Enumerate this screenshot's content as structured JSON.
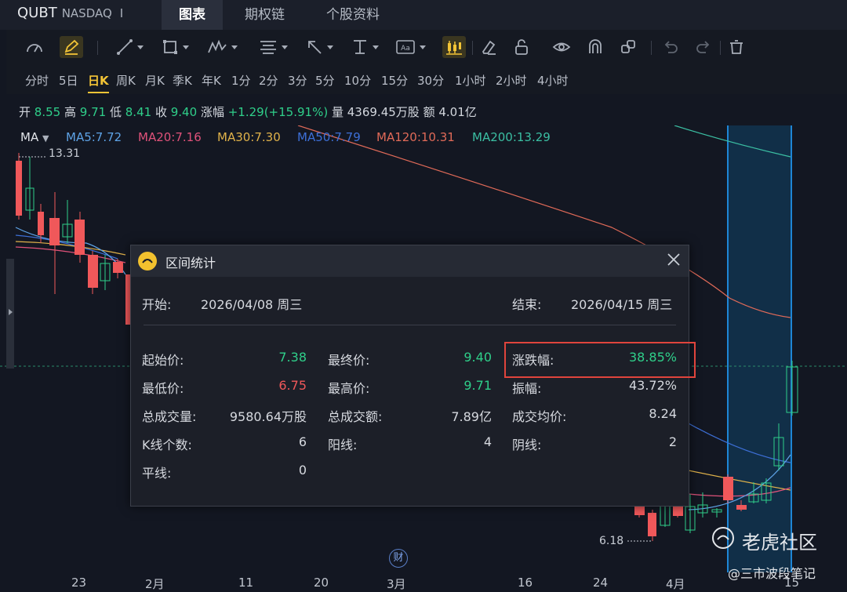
{
  "header": {
    "symbol": "QUBT",
    "exchange": "NASDAQ",
    "separator": "I",
    "tabs": [
      {
        "label": "图表",
        "active": true
      },
      {
        "label": "期权链",
        "active": false
      },
      {
        "label": "个股资料",
        "active": false
      }
    ]
  },
  "toolbar": {
    "icons": [
      "gauge-icon",
      "pencil-icon",
      "line-icon",
      "rectangle-icon",
      "pattern-icon",
      "fib-icon",
      "arrow-icon",
      "measure-icon",
      "text-icon",
      "candle-settings-icon",
      "eraser-icon",
      "lock-icon",
      "eye-icon",
      "magnet-icon",
      "layers-icon",
      "undo-icon",
      "redo-icon",
      "trash-icon"
    ],
    "accent": "#f3c436"
  },
  "periods": [
    "分时",
    "5日",
    "日K",
    "周K",
    "月K",
    "季K",
    "年K",
    "1分",
    "2分",
    "3分",
    "5分",
    "10分",
    "15分",
    "30分",
    "1小时",
    "2小时",
    "4小时"
  ],
  "active_period": "日K",
  "quote": {
    "open_label": "开",
    "open": "8.55",
    "high_label": "高",
    "high": "9.71",
    "low_label": "低",
    "low": "8.41",
    "close_label": "收",
    "close": "9.40",
    "change_label": "涨幅",
    "change": "+1.29(+15.91%)",
    "volume_label": "量",
    "volume": "4369.45万股",
    "amount_label": "额",
    "amount": "4.01亿"
  },
  "ma": {
    "label": "MA",
    "items": [
      {
        "text": "MA5:7.72",
        "color": "#5ea3e6"
      },
      {
        "text": "MA20:7.16",
        "color": "#e0527a"
      },
      {
        "text": "MA30:7.30",
        "color": "#e0b24a"
      },
      {
        "text": "MA50:7.79",
        "color": "#3d6fd6"
      },
      {
        "text": "MA120:10.31",
        "color": "#e06a58"
      },
      {
        "text": "MA200:13.29",
        "color": "#3bbfa3"
      }
    ]
  },
  "chart_labels": {
    "high_mark": "13.31",
    "low_mark": "6.18",
    "finance_badge": "财"
  },
  "xaxis": [
    "23",
    "2月",
    "11",
    "20",
    "3月",
    "16",
    "24",
    "4月",
    "15"
  ],
  "watermark": {
    "brand": "老虎社区",
    "author": "@三市波段笔记"
  },
  "dialog": {
    "title": "区间统计",
    "start_label": "开始:",
    "start": "2026/04/08 周三",
    "end_label": "结束:",
    "end": "2026/04/15 周三",
    "start_price_label": "起始价:",
    "start_price": "7.38",
    "final_price_label": "最终价:",
    "final_price": "9.40",
    "change_label": "涨跌幅:",
    "change": "38.85%",
    "low_label": "最低价:",
    "low": "6.75",
    "high_label": "最高价:",
    "high": "9.71",
    "amplitude_label": "振幅:",
    "amplitude": "43.72%",
    "total_volume_label": "总成交量:",
    "total_volume": "9580.64万股",
    "total_amount_label": "总成交额:",
    "total_amount": "7.89亿",
    "avg_price_label": "成交均价:",
    "avg_price": "8.24",
    "kline_count_label": "K线个数:",
    "kline_count": "6",
    "up_label": "阳线:",
    "up": "4",
    "down_label": "阴线:",
    "down": "2",
    "flat_label": "平线:",
    "flat": "0"
  },
  "colors": {
    "up": "#2fcf8a",
    "down": "#f0585a",
    "range": "#1e86d6"
  }
}
